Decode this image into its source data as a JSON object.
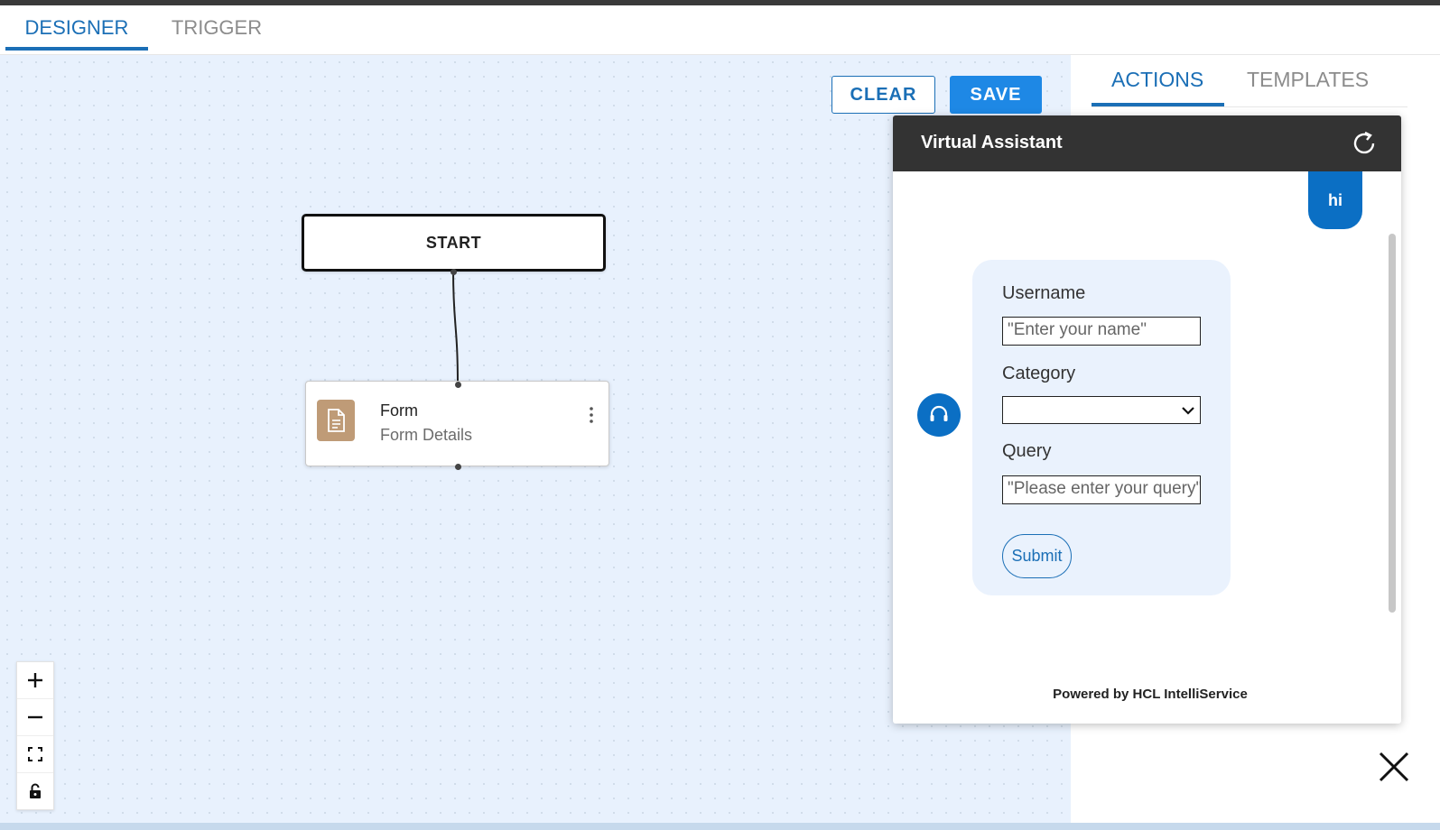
{
  "tabs": [
    {
      "label": "DESIGNER",
      "active": true
    },
    {
      "label": "TRIGGER",
      "active": false
    }
  ],
  "toolbar": {
    "clear_label": "CLEAR",
    "save_label": "SAVE"
  },
  "flow": {
    "start_label": "START",
    "form_node": {
      "title": "Form",
      "subtitle": "Form Details",
      "icon": "document-icon",
      "menu_icon": "more-vertical-icon"
    }
  },
  "zoom_controls": [
    {
      "name": "zoom-in",
      "icon": "plus-icon"
    },
    {
      "name": "zoom-out",
      "icon": "minus-icon"
    },
    {
      "name": "fit-view",
      "icon": "fit-view-icon"
    },
    {
      "name": "lock",
      "icon": "lock-icon"
    }
  ],
  "side_panel": {
    "tabs": [
      {
        "label": "ACTIONS",
        "active": true
      },
      {
        "label": "TEMPLATES",
        "active": false
      }
    ],
    "accent_colors": [
      "#f0901e",
      "#4a9a8c",
      "#2b2f3a"
    ]
  },
  "virtual_assistant": {
    "title": "Virtual Assistant",
    "refresh_icon": "refresh-icon",
    "user_message": "hi",
    "agent_icon": "headset-icon",
    "form": {
      "username_label": "Username",
      "username_placeholder": "\"Enter your name\"",
      "category_label": "Category",
      "category_value": "",
      "query_label": "Query",
      "query_placeholder": "\"Please enter your query\"",
      "submit_label": "Submit"
    },
    "footer": "Powered by HCL IntelliService",
    "close_icon": "close-icon"
  },
  "colors": {
    "primary": "#1b6fb6",
    "save": "#1e88e5",
    "canvas_bg": "#e8f1fd",
    "va_header": "#333333",
    "chat_blue": "#0b6fc4",
    "form_icon": "#bf9b77"
  }
}
